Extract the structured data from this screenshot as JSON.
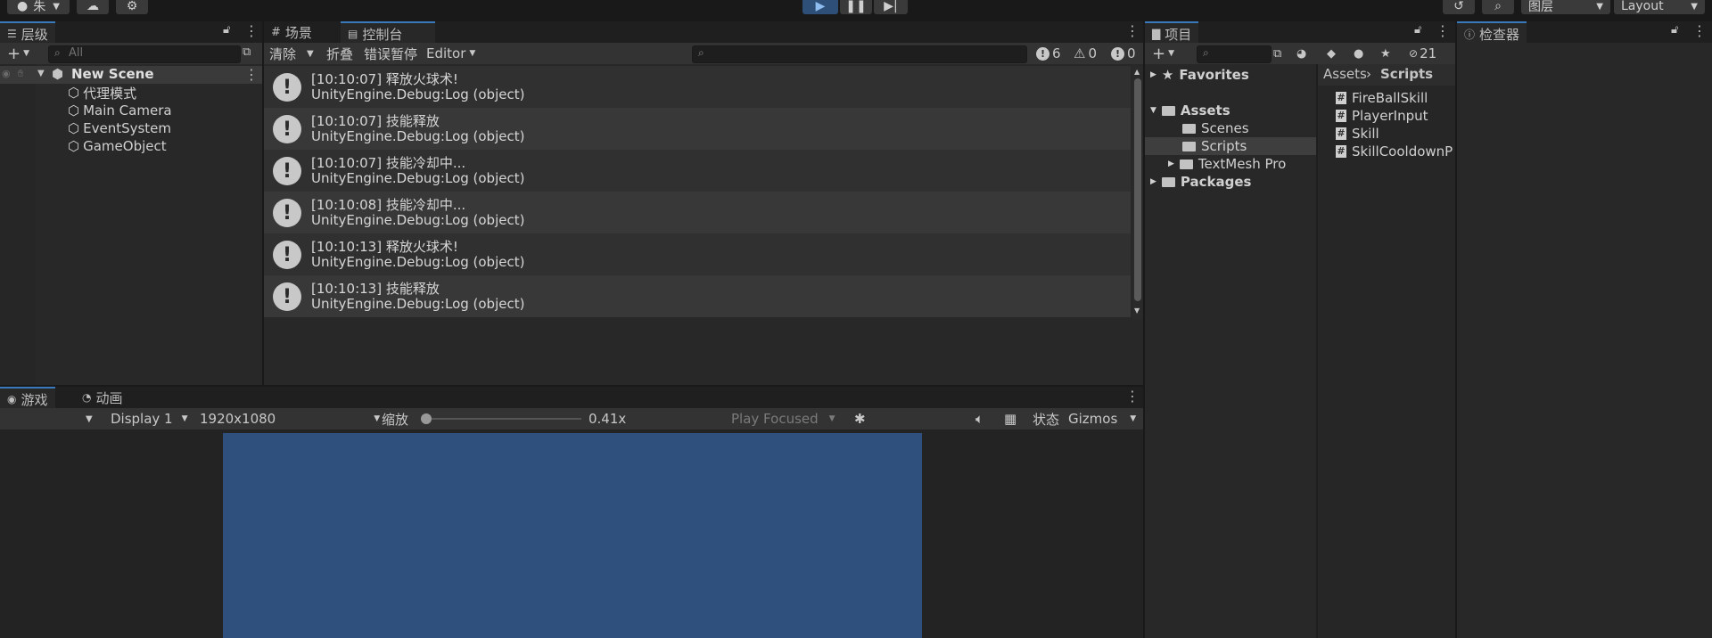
{
  "toolbar": {
    "account": "朱",
    "layers": "图层",
    "layout": "Layout"
  },
  "hierarchy": {
    "tab": "层级",
    "search_placeholder": "All",
    "scene": "New Scene",
    "items": [
      "代理模式",
      "Main Camera",
      "EventSystem",
      "GameObject"
    ]
  },
  "center_tabs": {
    "scene": "场景",
    "console": "控制台"
  },
  "console": {
    "clear": "清除",
    "collapse": "折叠",
    "error_pause": "错误暂停",
    "editor": "Editor",
    "log_count": "6",
    "warn_count": "0",
    "error_count": "0",
    "entries": [
      {
        "line1": "[10:10:07] 释放火球术!",
        "line2": "UnityEngine.Debug:Log (object)"
      },
      {
        "line1": "[10:10:07] 技能释放",
        "line2": "UnityEngine.Debug:Log (object)"
      },
      {
        "line1": "[10:10:07] 技能冷却中...",
        "line2": "UnityEngine.Debug:Log (object)"
      },
      {
        "line1": "[10:10:08] 技能冷却中...",
        "line2": "UnityEngine.Debug:Log (object)"
      },
      {
        "line1": "[10:10:13] 释放火球术!",
        "line2": "UnityEngine.Debug:Log (object)"
      },
      {
        "line1": "[10:10:13] 技能释放",
        "line2": "UnityEngine.Debug:Log (object)"
      }
    ]
  },
  "game": {
    "tab_game": "游戏",
    "tab_anim": "动画",
    "display": "Display 1",
    "resolution": "1920x1080",
    "scale_label": "缩放",
    "scale_value": "0.41x",
    "scale_fraction": 0.0,
    "play_mode": "Play Focused",
    "stats": "状态",
    "gizmos": "Gizmos",
    "viewport_color": "#2f4f7d"
  },
  "project": {
    "tab": "项目",
    "hidden_count": "21",
    "favorites": "Favorites",
    "assets": "Assets",
    "folders": [
      "Scenes",
      "Scripts",
      "TextMesh Pro"
    ],
    "packages": "Packages",
    "breadcrumb_root": "Assets",
    "breadcrumb_current": "Scripts",
    "files": [
      "FireBallSkill",
      "PlayerInput",
      "Skill",
      "SkillCooldownP"
    ]
  },
  "inspector": {
    "tab": "检查器"
  },
  "colors": {
    "accent": "#3a79bb",
    "selected": "#3e3e3e"
  }
}
